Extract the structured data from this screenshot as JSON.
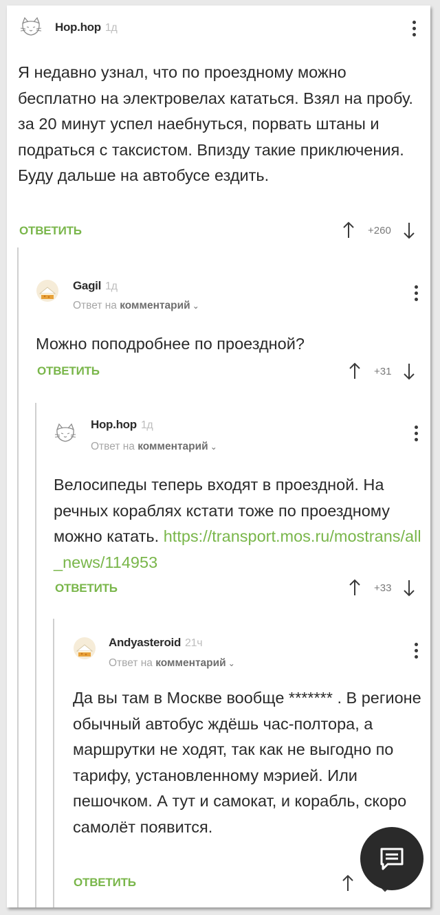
{
  "icons": {
    "cat_avatar": "cat-sketch-icon",
    "cake_avatar": "cake-avatar-icon",
    "more": "kebab-menu-icon",
    "upvote": "arrow-up-icon",
    "downvote": "arrow-down-icon",
    "fab": "chat-icon"
  },
  "colors": {
    "accent": "#79b64a",
    "fab_bg": "#2a2a2a",
    "thread_line": "#cfcfcf"
  },
  "comments": [
    {
      "username": "Hop.hop",
      "time": "1д",
      "body": "Я недавно узнал, что по проездному можно бесплатно на электровелах кататься. Взял на пробу. за 20 минут успел наебнуться, порвать штаны и подраться с таксистом. Впизду такие приключения. Буду дальше на автобусе ездить.",
      "reply_label": "ОТВЕТИТЬ",
      "score": "+260"
    },
    {
      "username": "Gagil",
      "time": "1д",
      "reply_prefix": "Ответ на",
      "reply_target": "комментарий",
      "body": "Можно поподробнее по проездной?",
      "reply_label": "ОТВЕТИТЬ",
      "score": "+31"
    },
    {
      "username": "Hop.hop",
      "time": "1д",
      "reply_prefix": "Ответ на",
      "reply_target": "комментарий",
      "body": "Велосипеды теперь входят в проездной. На речных кораблях кстати тоже по проездному можно катать.",
      "link": "https://transport.mos.ru/mostrans/all_news/114953",
      "reply_label": "ОТВЕТИТЬ",
      "score": "+33"
    },
    {
      "username": "Andyasteroid",
      "time": "21ч",
      "reply_prefix": "Ответ на",
      "reply_target": "комментарий",
      "body": "Да вы там в Москве вообще ******* . В регионе обычный автобус ждёшь час-полтора, а маршрутки не ходят, так как не выгодно по тарифу, установленному мэрией. Или пешочком. А тут и самокат, и корабль, скоро самолёт появится.",
      "reply_label": "ОТВЕТИТЬ",
      "score": ""
    }
  ]
}
